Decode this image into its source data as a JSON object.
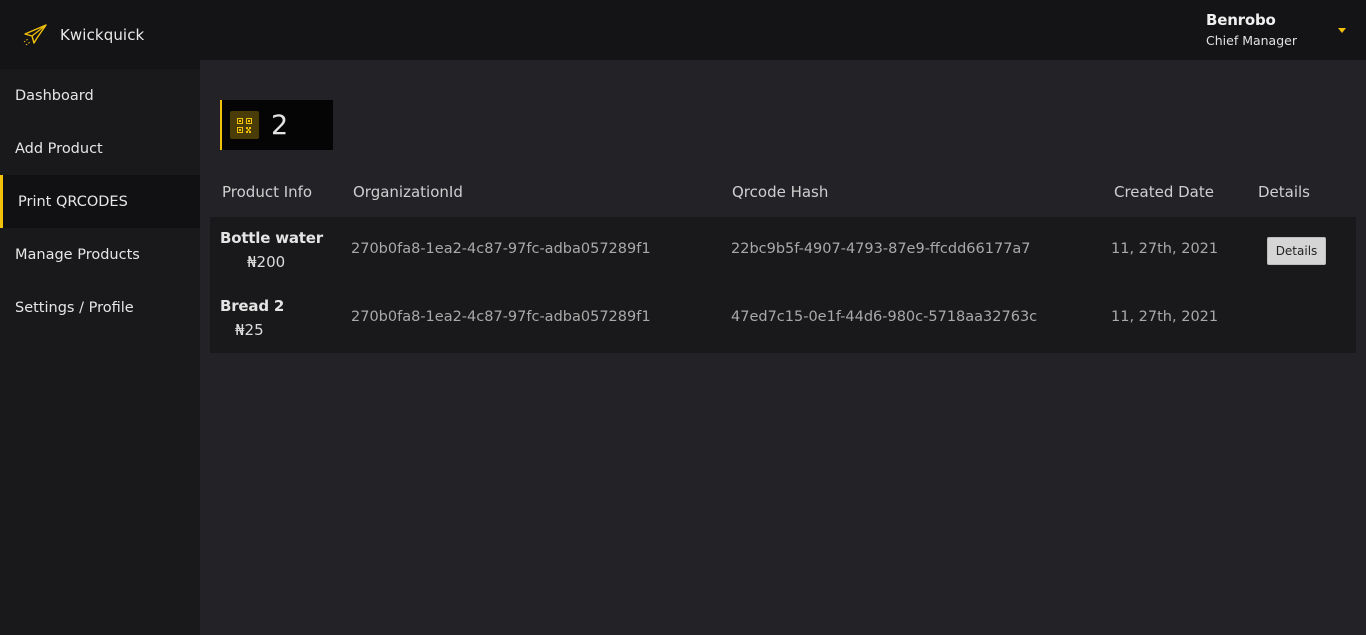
{
  "app": {
    "name": "Kwickquick"
  },
  "sidebar": {
    "items": [
      {
        "label": "Dashboard"
      },
      {
        "label": "Add Product"
      },
      {
        "label": "Print QRCODES",
        "active": true
      },
      {
        "label": "Manage Products"
      },
      {
        "label": "Settings / Profile"
      }
    ]
  },
  "user": {
    "name": "Benrobo",
    "role": "Chief Manager"
  },
  "stat": {
    "icon": "qrcode-icon",
    "count": "2"
  },
  "table": {
    "headers": [
      "Product Info",
      "OrganizationId",
      "Qrcode Hash",
      "Created Date",
      "Details"
    ],
    "rows": [
      {
        "name": "Bottle water",
        "price": "₦200",
        "organization_id": "270b0fa8-1ea2-4c87-97fc-adba057289f1",
        "qrcode_hash": "22bc9b5f-4907-4793-87e9-ffcdd66177a7",
        "created_date": "11, 27th, 2021",
        "details_label": "Details"
      },
      {
        "name": "Bread 2",
        "price": "₦25",
        "organization_id": "270b0fa8-1ea2-4c87-97fc-adba057289f1",
        "qrcode_hash": "47ed7c15-0e1f-44d6-980c-5718aa32763c",
        "created_date": "11, 27th, 2021"
      }
    ]
  },
  "colors": {
    "accent": "#f2c10a",
    "background": "#232226",
    "sidebar": "#19191b"
  }
}
